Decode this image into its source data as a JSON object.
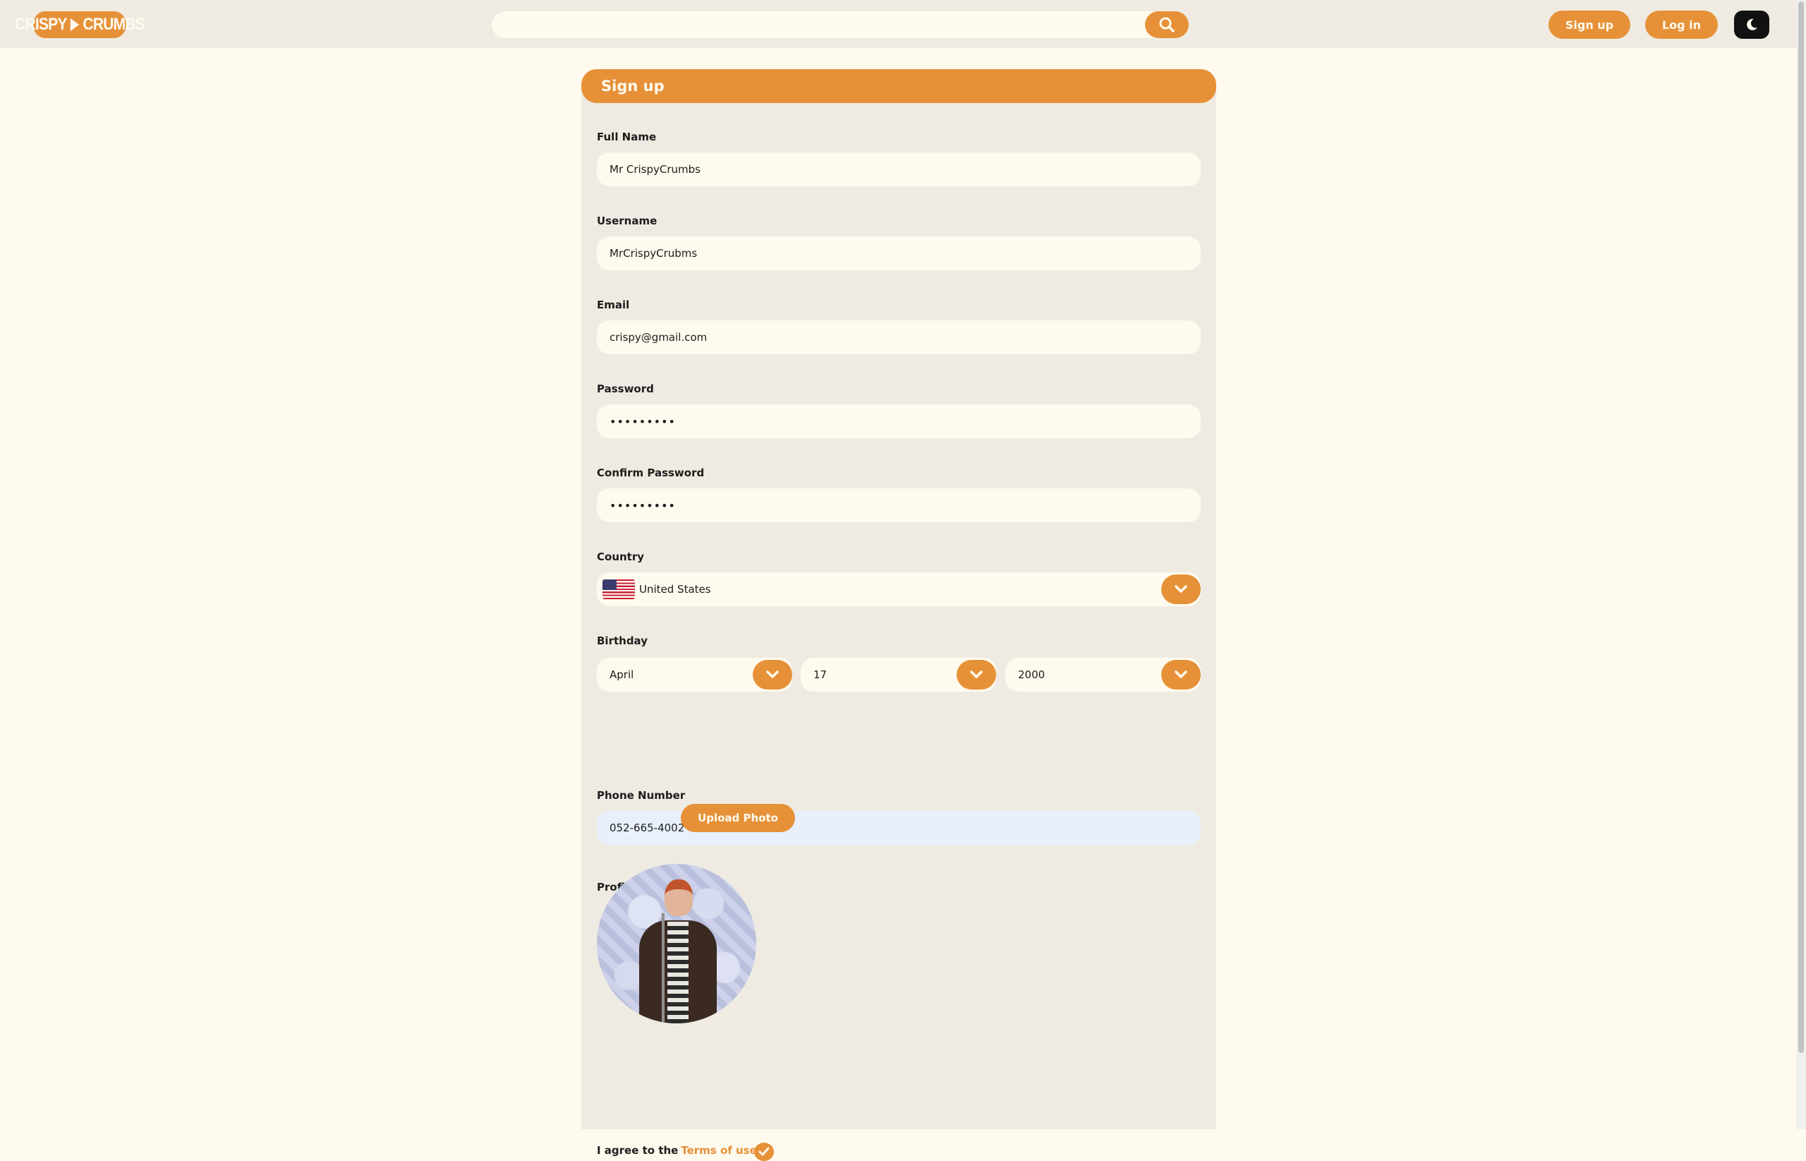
{
  "header": {
    "logo_left": "CRISPY",
    "logo_right": "CRUMBS",
    "search_placeholder": "",
    "signup_label": "Sign up",
    "login_label": "Log in",
    "icons": [
      "search-icon",
      "moon-icon"
    ]
  },
  "form": {
    "title": "Sign up",
    "full_name": {
      "label": "Full Name",
      "value": "Mr CrispyCrumbs"
    },
    "username": {
      "label": "Username",
      "value": "MrCrispyCrubms"
    },
    "email": {
      "label": "Email",
      "value": "crispy@gmail.com"
    },
    "password": {
      "label": "Password",
      "value": "•••••••••"
    },
    "confirm_password": {
      "label": "Confirm Password",
      "value": "•••••••••"
    },
    "country": {
      "label": "Country",
      "value": "United States",
      "flag": "us-flag-icon"
    },
    "birthday": {
      "label": "Birthday",
      "month": "April",
      "day": "17",
      "year": "2000"
    },
    "phone": {
      "label": "Phone Number",
      "value": "052-665-4002"
    },
    "profile_photo": {
      "label": "Profile Photo",
      "upload_label": "Upload Photo"
    },
    "terms": {
      "prefix": "I agree to the",
      "link": "Terms of use",
      "checked": true
    }
  },
  "colors": {
    "accent": "#e69138",
    "background": "#fffaee",
    "panel": "#efebe2",
    "autofill": "#e8f0fe"
  }
}
